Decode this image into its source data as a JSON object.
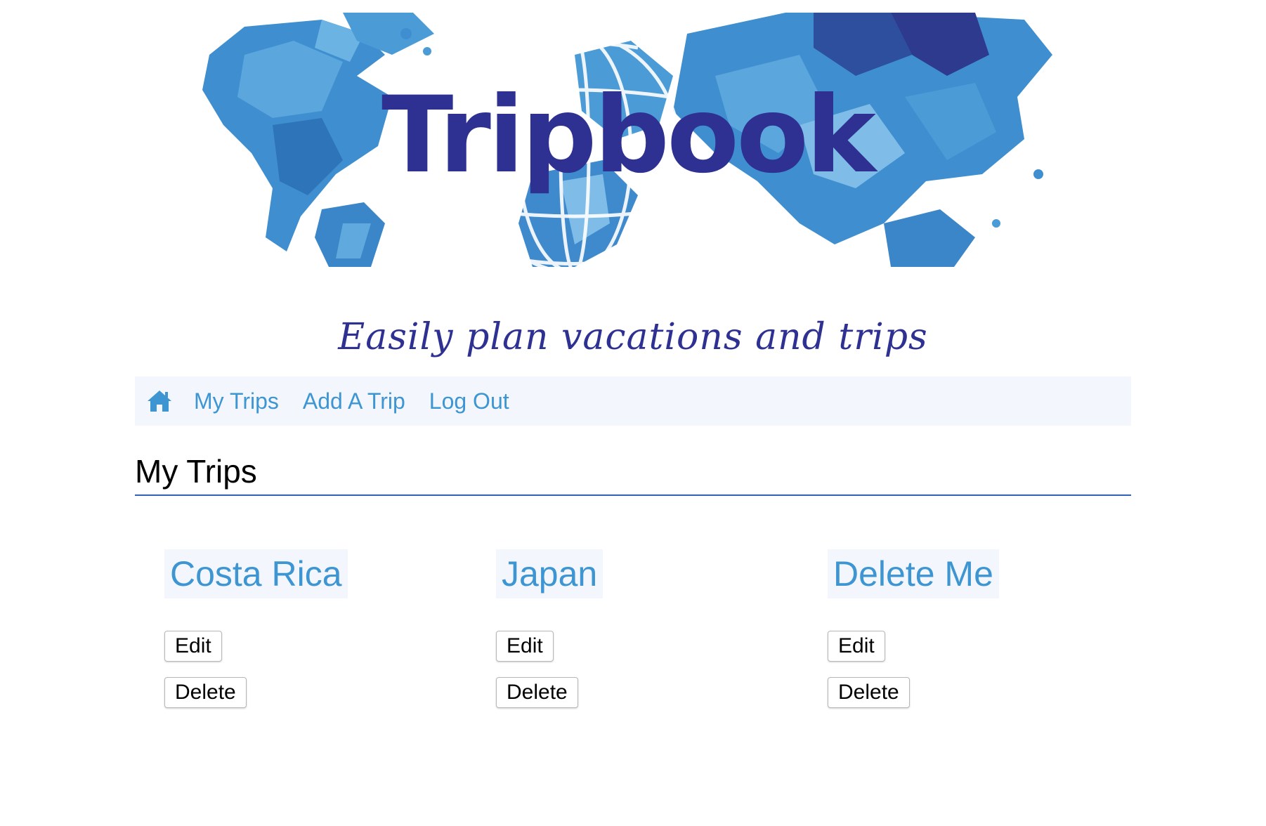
{
  "banner": {
    "logo_text": "Tripbook"
  },
  "tagline": "Easily plan vacations and trips",
  "nav": {
    "home_icon": "home-icon",
    "links": [
      "My Trips",
      "Add A Trip",
      "Log Out"
    ]
  },
  "section": {
    "title": "My Trips"
  },
  "trips": [
    {
      "name": "Costa Rica",
      "edit_label": "Edit",
      "delete_label": "Delete"
    },
    {
      "name": "Japan",
      "edit_label": "Edit",
      "delete_label": "Delete"
    },
    {
      "name": "Delete Me",
      "edit_label": "Edit",
      "delete_label": "Delete"
    }
  ],
  "colors": {
    "brand_navy": "#2e3192",
    "link_blue": "#3d95d2",
    "nav_background": "#f3f7fd",
    "rule_blue": "#2f61b9"
  }
}
